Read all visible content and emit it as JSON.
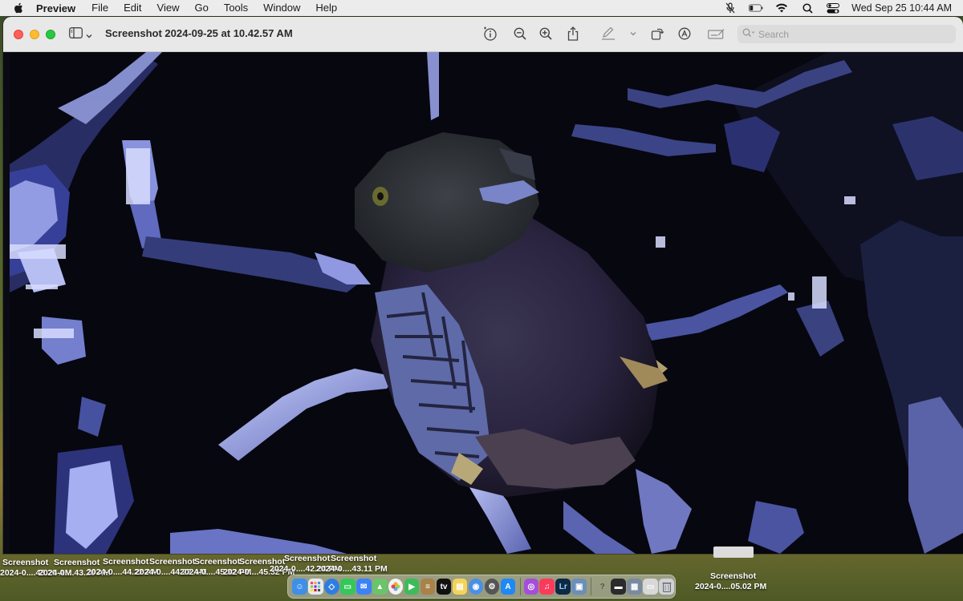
{
  "menubar": {
    "app_name": "Preview",
    "menus": [
      "File",
      "Edit",
      "View",
      "Go",
      "Tools",
      "Window",
      "Help"
    ],
    "clock": "Wed Sep 25  10:44 AM",
    "icons": [
      "mic-off-icon",
      "battery-icon",
      "wifi-icon",
      "search-icon",
      "control-center-icon"
    ]
  },
  "window": {
    "title": "Screenshot 2024-09-25 at 10.42.57 AM",
    "search": {
      "placeholder": "Search",
      "value": ""
    },
    "toolbar": [
      "info-icon",
      "zoom-out-icon",
      "zoom-in-icon",
      "share-icon",
      "markup-icon",
      "chevron-down-icon",
      "rotate-icon",
      "annotate-icon",
      "form-icon"
    ],
    "image_subject": "owl-on-branch"
  },
  "desktop": {
    "files": [
      {
        "name": "Screenshot",
        "sub": "2024-0....43.20 AM"
      },
      {
        "name": "Screenshot",
        "sub": "2024-0....43.20 AM"
      },
      {
        "name": "Screenshot",
        "sub": "2024-0....44.22 AM"
      },
      {
        "name": "Screenshot",
        "sub": "2024-0....44.22 AM"
      },
      {
        "name": "Screenshot",
        "sub": "2024-0....45.32 PM"
      },
      {
        "name": "Screenshot",
        "sub": "2024-0....45.32 PM"
      },
      {
        "name": "Screenshot",
        "sub": "2024-0....42.24 PM"
      },
      {
        "name": "Screenshot",
        "sub": "2024-0....43.11 PM"
      },
      {
        "name": "Screenshot",
        "sub": "2024-0....05.02 PM"
      }
    ]
  },
  "dock": {
    "apps": [
      "finder",
      "launchpad",
      "safari",
      "messages",
      "mail",
      "maps",
      "facetime",
      "notes-brown",
      "tv",
      "notes",
      "photos",
      "chrome",
      "app-store",
      "podcasts",
      "music",
      "lightroom",
      "preview",
      "help",
      "terminal",
      "system",
      "screen",
      "trash"
    ]
  }
}
